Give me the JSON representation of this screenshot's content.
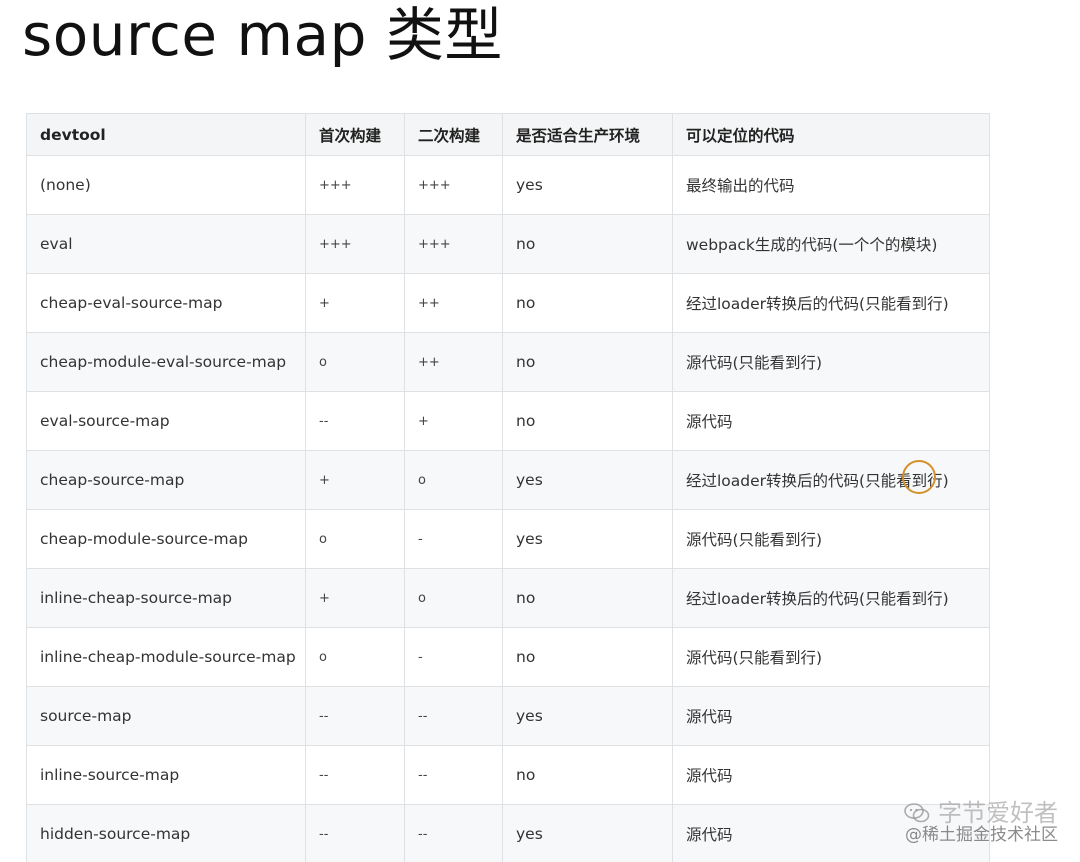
{
  "title": "source map 类型",
  "table": {
    "headers": [
      "devtool",
      "首次构建",
      "二次构建",
      "是否适合生产环境",
      "可以定位的代码"
    ],
    "rows": [
      [
        "(none)",
        "+++",
        "+++",
        "yes",
        "最终输出的代码"
      ],
      [
        "eval",
        "+++",
        "+++",
        "no",
        "webpack生成的代码(一个个的模块)"
      ],
      [
        "cheap-eval-source-map",
        "+",
        "++",
        "no",
        "经过loader转换后的代码(只能看到行)"
      ],
      [
        "cheap-module-eval-source-map",
        "o",
        "++",
        "no",
        "源代码(只能看到行)"
      ],
      [
        "eval-source-map",
        "--",
        "+",
        "no",
        "源代码"
      ],
      [
        "cheap-source-map",
        "+",
        "o",
        "yes",
        "经过loader转换后的代码(只能看到行)"
      ],
      [
        "cheap-module-source-map",
        "o",
        "-",
        "yes",
        "源代码(只能看到行)"
      ],
      [
        "inline-cheap-source-map",
        "+",
        "o",
        "no",
        "经过loader转换后的代码(只能看到行)"
      ],
      [
        "inline-cheap-module-source-map",
        "o",
        "-",
        "no",
        "源代码(只能看到行)"
      ],
      [
        "source-map",
        "--",
        "--",
        "yes",
        "源代码"
      ],
      [
        "inline-source-map",
        "--",
        "--",
        "no",
        "源代码"
      ],
      [
        "hidden-source-map",
        "--",
        "--",
        "yes",
        "源代码"
      ]
    ]
  },
  "watermark": {
    "line1": "字节爱好者",
    "line2": "@稀土掘金技术社区",
    "icon": "wechat-icon"
  },
  "annotation": {
    "icon": "circle-highlight-icon",
    "color": "#d4902a"
  }
}
